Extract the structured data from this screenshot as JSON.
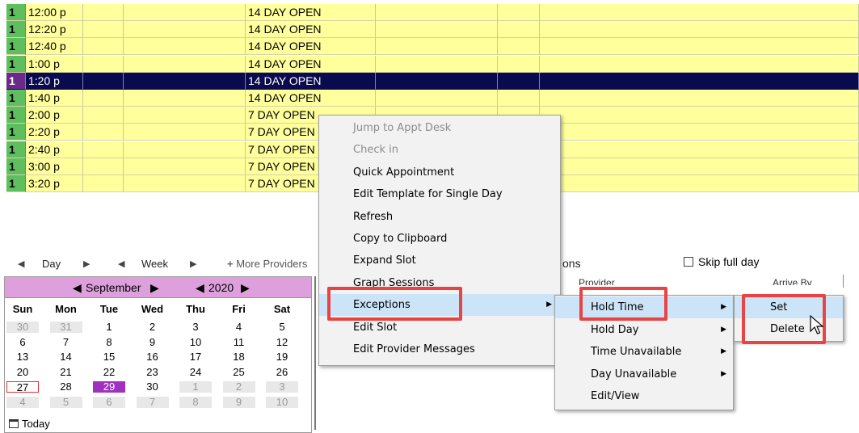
{
  "schedule": {
    "rows": [
      {
        "num": "1",
        "time": "12:00 p",
        "desc": "14 DAY OPEN"
      },
      {
        "num": "1",
        "time": "12:20 p",
        "desc": "14 DAY OPEN"
      },
      {
        "num": "1",
        "time": "12:40 p",
        "desc": "14 DAY OPEN"
      },
      {
        "num": "1",
        "time": "1:00 p",
        "desc": "14 DAY OPEN"
      },
      {
        "num": "1",
        "time": "1:20 p",
        "desc": "14 DAY OPEN"
      },
      {
        "num": "1",
        "time": "1:40 p",
        "desc": "14 DAY OPEN"
      },
      {
        "num": "1",
        "time": "2:00 p",
        "desc": "7 DAY OPEN"
      },
      {
        "num": "1",
        "time": "2:20 p",
        "desc": "7 DAY OPEN"
      },
      {
        "num": "1",
        "time": "2:40 p",
        "desc": "7 DAY OPEN"
      },
      {
        "num": "1",
        "time": "3:00 p",
        "desc": "7 DAY OPEN"
      },
      {
        "num": "1",
        "time": "3:20 p",
        "desc": "7 DAY OPEN"
      }
    ],
    "selected_index": 4
  },
  "nav": {
    "day_label": "Day",
    "week_label": "Week",
    "more_providers_label": "More Providers",
    "options_fragment": "ons",
    "skip_full_day_label": "Skip full day"
  },
  "calendar": {
    "month": "September",
    "year": "2020",
    "dows": [
      "Sun",
      "Mon",
      "Tue",
      "Wed",
      "Thu",
      "Fri",
      "Sat"
    ],
    "weeks": [
      [
        "30",
        "31",
        "1",
        "2",
        "3",
        "4",
        "5"
      ],
      [
        "6",
        "7",
        "8",
        "9",
        "10",
        "11",
        "12"
      ],
      [
        "13",
        "14",
        "15",
        "16",
        "17",
        "18",
        "19"
      ],
      [
        "20",
        "21",
        "22",
        "23",
        "24",
        "25",
        "26"
      ],
      [
        "27",
        "28",
        "29",
        "30",
        "1",
        "2",
        "3"
      ],
      [
        "4",
        "5",
        "6",
        "7",
        "8",
        "9",
        "10"
      ]
    ],
    "today_label": "Today"
  },
  "context_menu": {
    "items": [
      {
        "label": "Jump to Appt Desk",
        "enabled": false
      },
      {
        "label": "Check in",
        "enabled": false
      },
      {
        "label": "Quick Appointment",
        "enabled": true
      },
      {
        "label": "Edit Template for Single Day",
        "enabled": true
      },
      {
        "label": "Refresh",
        "enabled": true
      },
      {
        "label": "Copy to Clipboard",
        "enabled": true
      },
      {
        "label": "Expand Slot",
        "enabled": true
      },
      {
        "label": "Graph Sessions",
        "enabled": true
      },
      {
        "label": "Exceptions",
        "enabled": true,
        "submenu": true
      },
      {
        "label": "Edit Slot",
        "enabled": true
      },
      {
        "label": "Edit Provider Messages",
        "enabled": true
      }
    ]
  },
  "exceptions_menu": {
    "items": [
      {
        "label": "Hold Time",
        "submenu": true
      },
      {
        "label": "Hold Day",
        "submenu": true
      },
      {
        "label": "Time Unavailable",
        "submenu": true
      },
      {
        "label": "Day Unavailable",
        "submenu": true
      },
      {
        "label": "Edit/View",
        "submenu": false
      }
    ]
  },
  "hold_time_menu": {
    "items": [
      {
        "label": "Set"
      },
      {
        "label": "Delete"
      }
    ]
  },
  "background_headers": {
    "provider": "Provider",
    "arrive_by": "Arrive By"
  },
  "colors": {
    "slot_yellow": "#ffff9c",
    "slot_green": "#5fbf5f",
    "selection_navy": "#0a0a4e",
    "calendar_header": "#dda0dd",
    "calendar_selected": "#a030c0",
    "highlight_red": "#e84444",
    "menu_hover": "#cce4f7"
  }
}
